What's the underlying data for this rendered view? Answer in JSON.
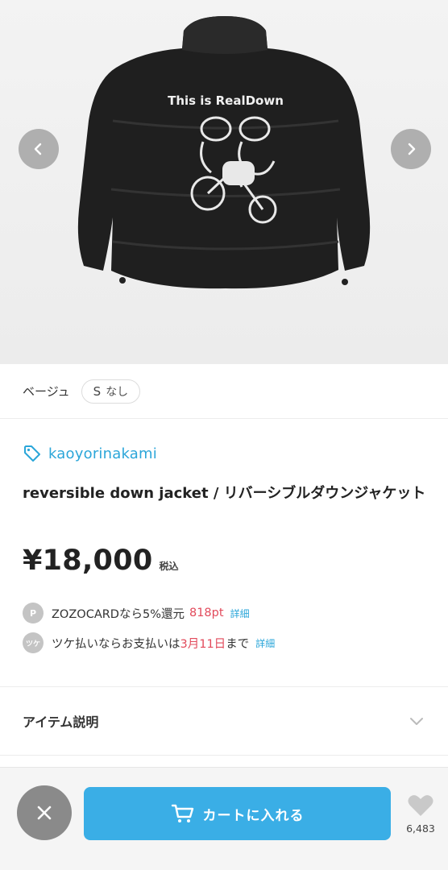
{
  "gallery": {
    "prev_icon": "chevron-left-icon",
    "next_icon": "chevron-right-icon",
    "print_text": "This is RealDown"
  },
  "variant": {
    "color": "ベージュ",
    "size": "S",
    "stock": "なし"
  },
  "product": {
    "brand": "kaoyorinakami",
    "title": "reversible down jacket / リバーシブルダウンジャケット",
    "price": "¥18,000",
    "tax_label": "税込"
  },
  "zozocard": {
    "badge": "P",
    "text": "ZOZOCARDなら5%還元",
    "points": "818pt",
    "detail_link": "詳細"
  },
  "tsuke": {
    "badge": "ツケ",
    "text_before": "ツケ払いならお支払いは",
    "date": "3月11日",
    "text_after": "まで",
    "detail_link": "詳細"
  },
  "description": {
    "label": "アイテム説明"
  },
  "bottom_bar": {
    "cart_label": "カートに入れる",
    "favorite_count": "6,483"
  },
  "colors": {
    "accent": "#3aaee6",
    "link": "#2ba6d9",
    "highlight": "#e24a5b"
  }
}
